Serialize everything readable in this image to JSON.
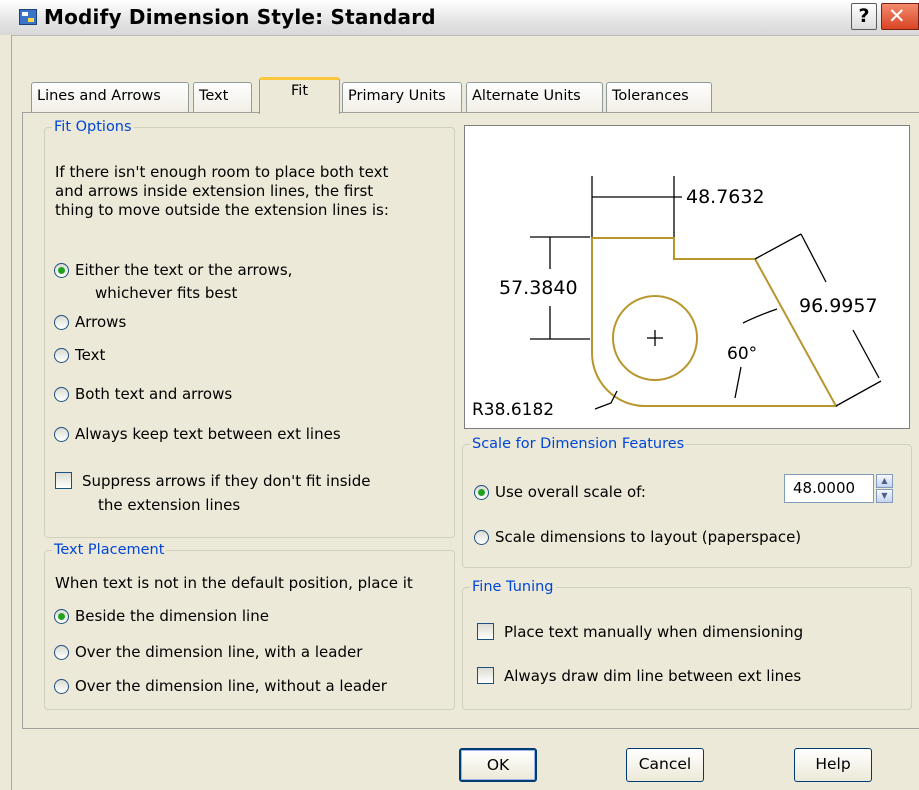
{
  "window": {
    "title": "Modify Dimension Style: Standard",
    "help_glyph": "?",
    "close_glyph": "✕"
  },
  "tabs": [
    {
      "label": "Lines and Arrows",
      "active": false
    },
    {
      "label": "Text",
      "active": false
    },
    {
      "label": "Fit",
      "active": true
    },
    {
      "label": "Primary Units",
      "active": false
    },
    {
      "label": "Alternate Units",
      "active": false
    },
    {
      "label": "Tolerances",
      "active": false
    }
  ],
  "fit_options": {
    "legend": "Fit Options",
    "description": [
      "If there isn't enough room to place both text",
      "and arrows inside extension lines, the first",
      "thing to move outside the extension lines is:"
    ],
    "options": [
      {
        "label": "Either the text or the arrows,",
        "label2": "whichever fits best",
        "selected": true
      },
      {
        "label": "Arrows",
        "selected": false
      },
      {
        "label": "Text",
        "selected": false
      },
      {
        "label": "Both text and arrows",
        "selected": false
      },
      {
        "label": "Always keep text between ext lines",
        "selected": false
      }
    ],
    "suppress": {
      "label": "Suppress arrows if they don't fit inside",
      "label2": "the extension lines",
      "checked": false
    }
  },
  "text_placement": {
    "legend": "Text Placement",
    "description": "When text is not in the default position, place it",
    "options": [
      {
        "label": "Beside the dimension line",
        "selected": true
      },
      {
        "label": "Over the dimension line, with a leader",
        "selected": false
      },
      {
        "label": "Over the dimension line, without a leader",
        "selected": false
      }
    ]
  },
  "preview": {
    "dim_top": "48.7632",
    "dim_left": "57.3840",
    "dim_right": "96.9957",
    "angle": "60°",
    "radius": "R38.6182",
    "outline_color": "#b8962e"
  },
  "scale": {
    "legend": "Scale for Dimension Features",
    "overall": {
      "label": "Use overall scale of:",
      "selected": true,
      "value": "48.0000"
    },
    "layout": {
      "label": "Scale dimensions to layout (paperspace)",
      "selected": false
    }
  },
  "fine_tuning": {
    "legend": "Fine Tuning",
    "manual": {
      "label": "Place text manually when dimensioning",
      "checked": false
    },
    "always_draw": {
      "label": "Always draw dim line between ext lines",
      "checked": false
    }
  },
  "buttons": {
    "ok": "OK",
    "cancel": "Cancel",
    "help": "Help"
  },
  "colors": {
    "legend": "#0046d5",
    "tab_highlight": "#ffc83c",
    "radio_dot": "#21a121"
  }
}
